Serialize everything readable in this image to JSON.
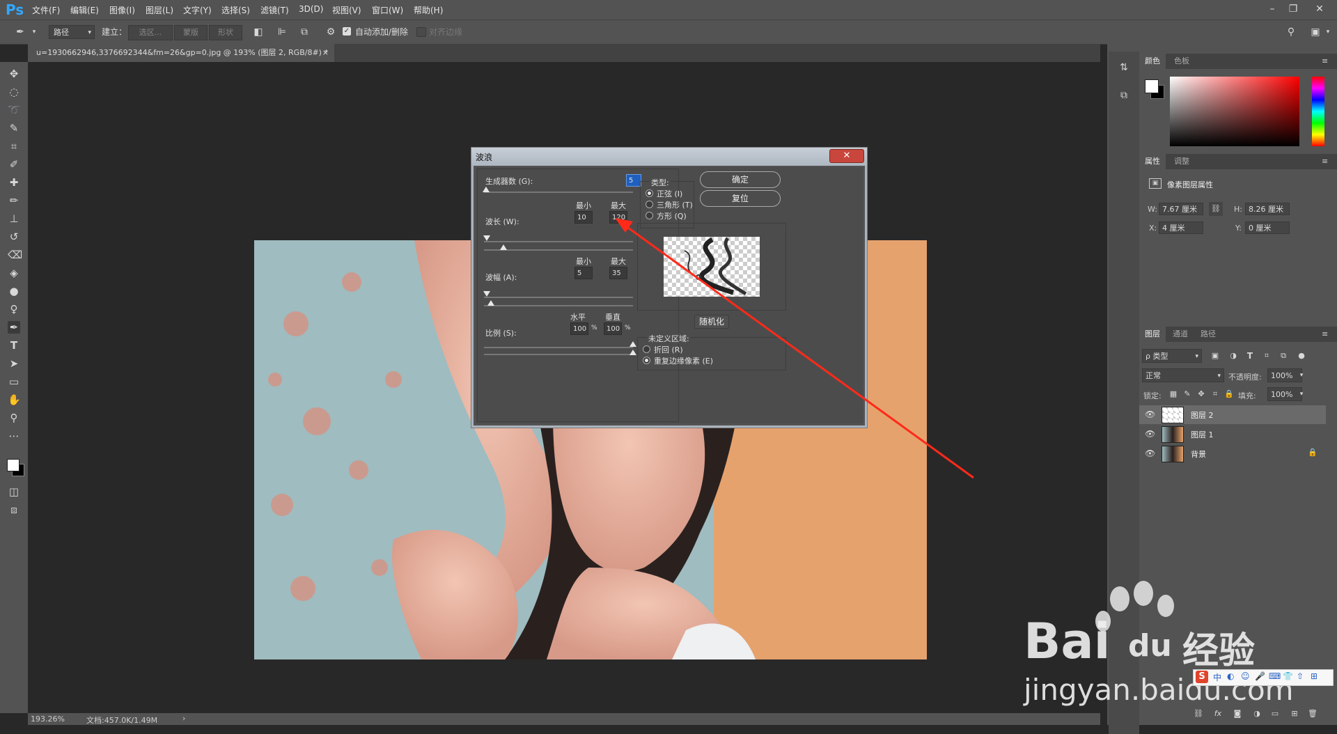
{
  "app": {
    "logo": "Ps"
  },
  "menu": [
    "文件(F)",
    "编辑(E)",
    "图像(I)",
    "图层(L)",
    "文字(Y)",
    "选择(S)",
    "滤镜(T)",
    "3D(D)",
    "视图(V)",
    "窗口(W)",
    "帮助(H)"
  ],
  "options_bar": {
    "mode_select": "路径",
    "make_label": "建立：",
    "selection_btn": "选区...",
    "mask_btn": "蒙版",
    "shape_btn": "形状",
    "auto_add_delete": "自动添加/删除",
    "align_edges": "对齐边缘"
  },
  "document_tab": {
    "title": "u=1930662946,3376692344&fm=26&gp=0.jpg @ 193% (图层 2, RGB/8#) *",
    "close": "×"
  },
  "status_bar": {
    "zoom": "193.26%",
    "doc_info": "文档:457.0K/1.49M",
    "arrow": "›"
  },
  "dialog": {
    "title": "波浪",
    "close": "✕",
    "generators_label": "生成器数 (G):",
    "generators_value": "5",
    "wavelength_label": "波长 (W):",
    "min_label": "最小",
    "max_label": "最大",
    "wavelength_min": "10",
    "wavelength_max": "120",
    "amplitude_label": "波幅 (A):",
    "amplitude_min": "5",
    "amplitude_max": "35",
    "scale_label": "比例 (S):",
    "horizontal_label": "水平",
    "vertical_label": "垂直",
    "scale_h": "100",
    "scale_v": "100",
    "percent": "%",
    "type_label": "类型:",
    "type_options": [
      "正弦 (I)",
      "三角形 (T)",
      "方形 (Q)"
    ],
    "type_selected": 0,
    "ok": "确定",
    "reset": "复位",
    "randomize": "随机化",
    "undefined_label": "未定义区域:",
    "undefined_options": [
      "折回 (R)",
      "重复边缘像素 (E)"
    ],
    "undefined_selected": 1
  },
  "color_panel": {
    "tabs": [
      "颜色",
      "色板"
    ]
  },
  "properties_panel": {
    "tabs": [
      "属性",
      "调整"
    ],
    "header": "像素图层属性",
    "w_label": "W:",
    "w_value": "7.67 厘米",
    "h_label": "H:",
    "h_value": "8.26 厘米",
    "x_label": "X:",
    "x_value": "4 厘米",
    "y_label": "Y:",
    "y_value": "0 厘米"
  },
  "layers_panel": {
    "tabs": [
      "图层",
      "通道",
      "路径"
    ],
    "filter": "ρ 类型",
    "blend_mode": "正常",
    "opacity_label": "不透明度:",
    "opacity": "100%",
    "lock_label": "锁定:",
    "fill_label": "填充:",
    "fill": "100%",
    "layers": [
      {
        "name": "图层 2",
        "selected": true
      },
      {
        "name": "图层 1",
        "selected": false
      },
      {
        "name": "背景",
        "selected": false
      }
    ]
  },
  "watermark": {
    "brand": "Bai",
    "brand2": "du",
    "text_cn": "经验",
    "url": "jingyan.baidu.com"
  },
  "colors": {
    "accent": "#31a8ff",
    "panel": "#535353",
    "canvas": "#282828",
    "arrow": "#ff2a1a"
  }
}
